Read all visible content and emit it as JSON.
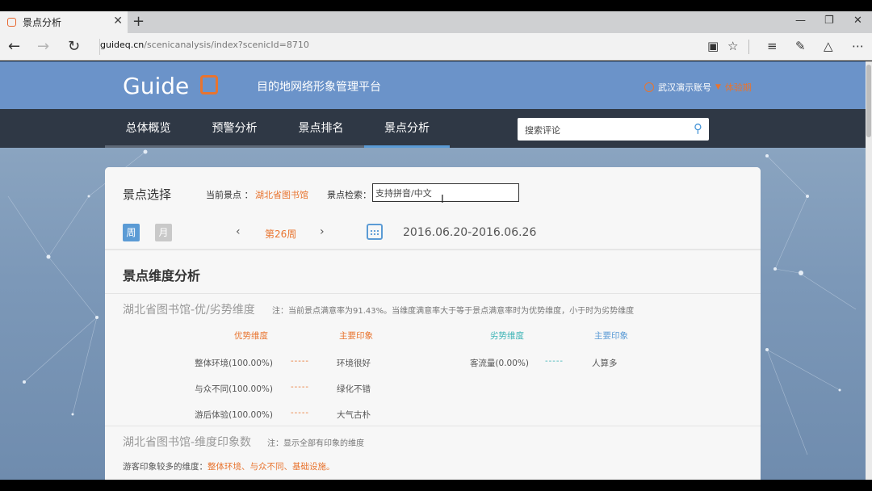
{
  "browser": {
    "tab_title": "景点分析",
    "new_tab": "+",
    "close": "✕",
    "url_domain": "guideq.cn",
    "url_path": "/scenicanalysis/index?scenicId=8710"
  },
  "header": {
    "logo_text": "Guide",
    "platform": "目的地网络形象管理平台",
    "account_name": "武汉演示账号",
    "account_status": "体验期"
  },
  "nav": {
    "items": [
      "总体概览",
      "预警分析",
      "景点排名",
      "景点分析"
    ],
    "active_index": 3,
    "search_placeholder": "搜索评论"
  },
  "selector": {
    "title": "景点选择",
    "current_label": "当前景点 ：",
    "current_value": "湖北省图书馆",
    "search_label": "景点检索：",
    "search_placeholder": "支持拼音/中文",
    "week_btn": "周",
    "month_btn": "月",
    "prev": "‹",
    "week_label": "第26周",
    "next": "›",
    "date_range": "2016.06.20-2016.06.26"
  },
  "analysis": {
    "title": "景点维度分析",
    "sub1_title": "湖北省图书馆-优/劣势维度",
    "sub1_note": "注：当前景点满意率为91.43%。当维度满意率大于等于景点满意率时为优势维度，小于时为劣势维度",
    "col_adv": "优势维度",
    "col_adv_imp": "主要印象",
    "col_dis": "劣势维度",
    "col_dis_imp": "主要印象",
    "advantages": [
      {
        "dim": "整体环境(100.00%)",
        "dash": "-----",
        "impression": "环境很好"
      },
      {
        "dim": "与众不同(100.00%)",
        "dash": "-----",
        "impression": "绿化不错"
      },
      {
        "dim": "游后体验(100.00%)",
        "dash": "-----",
        "impression": "大气古朴"
      }
    ],
    "disadvantages": [
      {
        "dim": "客流量(0.00%)",
        "dash": "-----",
        "impression": "人算多"
      }
    ],
    "sub2_title": "湖北省图书馆-维度印象数",
    "sub2_note": "注：显示全部有印象的维度",
    "many_label": "游客印象较多的维度：",
    "many_values": "整体环境、与众不同、基础设施。"
  },
  "colors": {
    "accent_orange": "#e8742f",
    "accent_blue": "#5b9bd5",
    "teal": "#3bb3b5",
    "header_blue": "#6b93c9",
    "nav_dark": "#2f3845"
  }
}
